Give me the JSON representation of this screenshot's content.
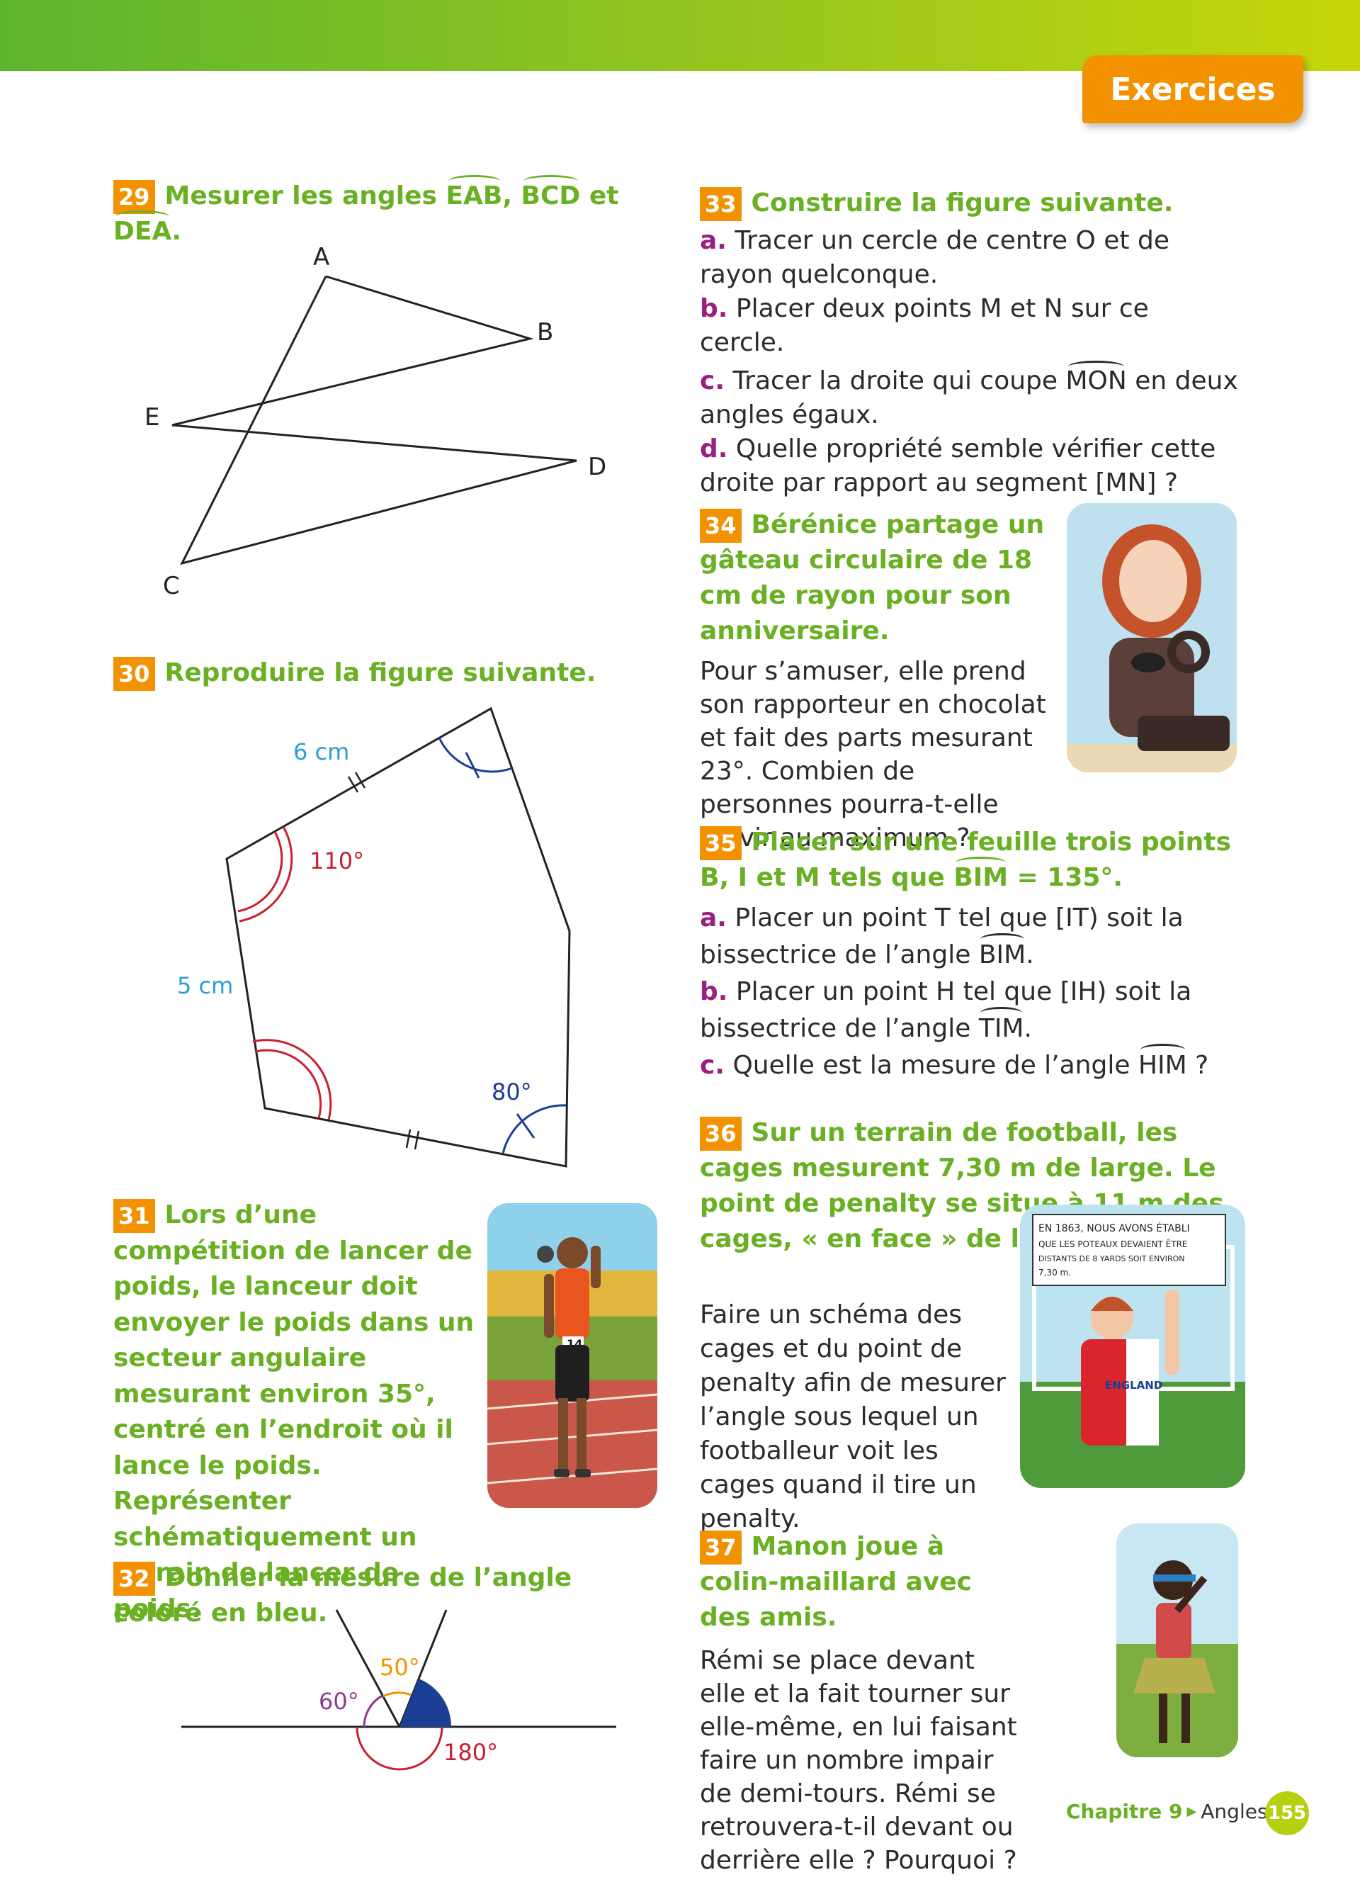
{
  "header": {
    "tab_label": "Exercices"
  },
  "ex29": {
    "number": "29",
    "title_pre": "Mesurer les angles ",
    "angle1": "EAB",
    "sep1": ", ",
    "angle2": "BCD",
    "sep2": " et ",
    "angle3": "DEA",
    "title_post": ".",
    "points": {
      "A": "A",
      "B": "B",
      "C": "C",
      "D": "D",
      "E": "E"
    }
  },
  "ex30": {
    "number": "30",
    "title": "Reproduire la figure suivante.",
    "labels": {
      "side_top": "6 cm",
      "side_left": "5 cm",
      "angle_red": "110°",
      "angle_blue": "80°"
    }
  },
  "ex31": {
    "number": "31",
    "text": "Lors d’une compétition de lancer de poids, le lanceur doit envoyer le poids dans un secteur angulaire mesurant environ 35°, centré en l’endroit où il lance le poids. Représenter schématiquement un terrain de lancer de poids.",
    "bib": "14"
  },
  "ex32": {
    "number": "32",
    "title": "Donner la mesure de l’angle coloré en bleu.",
    "labels": {
      "a50": "50°",
      "a60": "60°",
      "a180": "180°"
    }
  },
  "ex33": {
    "number": "33",
    "title": "Construire la figure suivante.",
    "a_letter": "a.",
    "a_text": " Tracer un cercle de centre O et de rayon quelconque.",
    "b_letter": "b.",
    "b_text": " Placer deux points M et N sur ce cercle.",
    "c_letter": "c.",
    "c_pre": " Tracer la droite qui coupe ",
    "c_angle": "MON",
    "c_post": " en deux angles égaux.",
    "d_letter": "d.",
    "d_text": " Quelle propriété semble vérifier cette droite par rapport au segment [MN] ?"
  },
  "ex34": {
    "number": "34",
    "title": "Bérénice partage un gâteau circulaire de 18 cm de rayon pour son anniversaire.",
    "text": "Pour s’amuser, elle prend son rapporteur en chocolat et fait des parts mesurant 23°. Combien de personnes pourra-t-elle servir au maximum ?"
  },
  "ex35": {
    "number": "35",
    "title_pre": "Placer sur une feuille trois points B, I et M tels que ",
    "title_angle": "BIM",
    "title_post": " = 135°.",
    "a_letter": "a.",
    "a_pre": " Placer un point T tel que [IT) soit la bissectrice de l’angle ",
    "a_angle": "BIM",
    "a_post": ".",
    "b_letter": "b.",
    "b_pre": " Placer un point H tel que [IH) soit la bissectrice de l’angle ",
    "b_angle": "TIM",
    "b_post": ".",
    "c_letter": "c.",
    "c_pre": " Quelle est la mesure de l’angle ",
    "c_angle": "HIM",
    "c_post": " ?"
  },
  "ex36": {
    "number": "36",
    "title": "Sur un terrain de football, les cages mesurent 7,30 m de large. Le point de penalty se situe à 11 m des cages, « en face » de leur milieu.",
    "text": "Faire un schéma des cages et du point de penalty afin de mesurer l’angle sous lequel un footballeur voit les cages quand il tire un penalty.",
    "sign_lines": [
      "EN 1863, NOUS AVONS ÉTABLI",
      "QUE LES POTEAUX DEVAIENT ÊTRE",
      "DISTANTS DE 8 YARDS SOIT ENVIRON",
      "7,30 m."
    ],
    "shirt": "ENGLAND"
  },
  "ex37": {
    "number": "37",
    "title": "Manon joue à colin-maillard avec des amis.",
    "text": "Rémi se place devant elle et la fait tourner sur elle-même, en lui faisant faire un nombre impair de demi-tours. Rémi se retrouvera-t-il devant ou derrière elle ? Pourquoi ?"
  },
  "footer": {
    "chapter": "Chapitre 9",
    "arrow": "▶",
    "topic": "Angles",
    "page": "155"
  },
  "colors": {
    "green": "#6ab023",
    "orange": "#f39200",
    "purple": "#9b1f7e",
    "red": "#c8202f",
    "blue": "#1b3f94",
    "cyan": "#2a9fd6"
  }
}
